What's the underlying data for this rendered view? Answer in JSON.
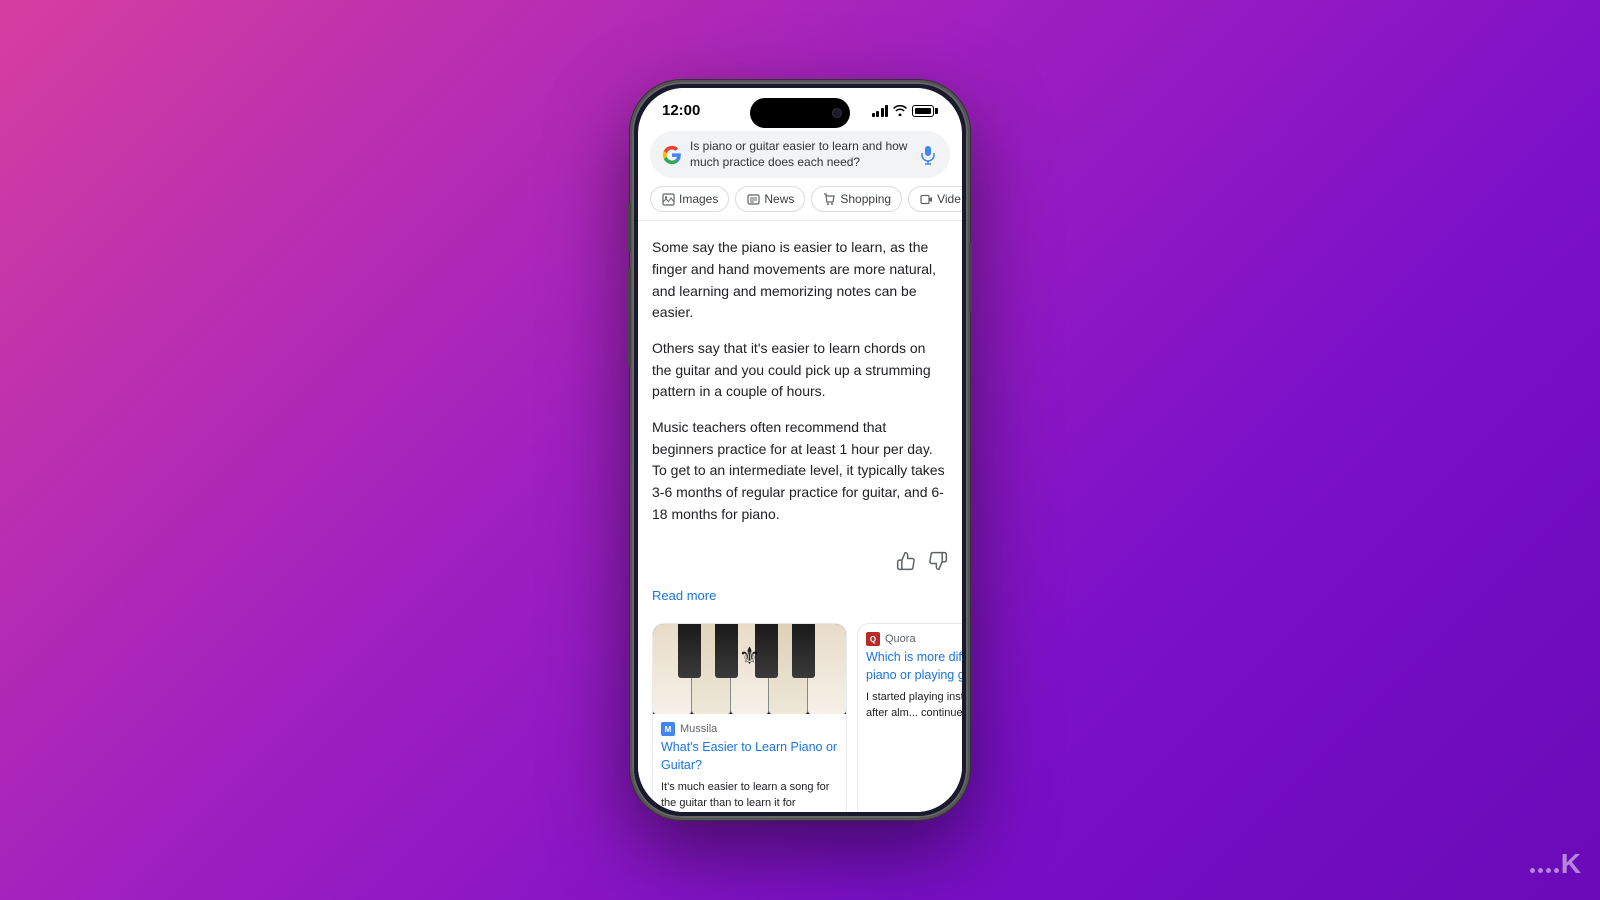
{
  "background": {
    "gradient_start": "#d63fa0",
    "gradient_end": "#6a0ab8"
  },
  "phone": {
    "status_bar": {
      "time": "12:00",
      "signal_label": "signal",
      "wifi_label": "wifi",
      "battery_label": "battery"
    },
    "search_bar": {
      "query": "Is piano or guitar easier to learn and how much practice does each need?",
      "mic_label": "microphone"
    },
    "filter_tabs": [
      {
        "label": "Images",
        "icon": "🖼"
      },
      {
        "label": "News",
        "icon": "📰"
      },
      {
        "label": "Shopping",
        "icon": "🛍"
      },
      {
        "label": "Vide…",
        "icon": "▶"
      }
    ],
    "answer_paragraphs": [
      "Some say the piano is easier to learn, as the finger and hand movements are more natural, and learning and memorizing notes can be easier.",
      "Others say that it's easier to learn chords on the guitar and you could pick up a strumming pattern in a couple of hours.",
      "Music teachers often recommend that beginners practice for at least 1 hour per day. To get to an intermediate level, it typically takes 3-6 months of regular practice for guitar, and 6-18 months for piano."
    ],
    "read_more_label": "Read more",
    "card1": {
      "source_name": "Mussila",
      "title": "What's Easier to Learn Piano or Guitar?",
      "snippet": "It's much easier to learn a song for the guitar than to learn it for"
    },
    "card2": {
      "source_name": "Quora",
      "title": "Which is more difficult, playing piano or playing guitar?",
      "snippet": "I started playing instruments th... now, after alm... continue to d... proficient..."
    }
  },
  "watermark": {
    "symbol": "K"
  }
}
